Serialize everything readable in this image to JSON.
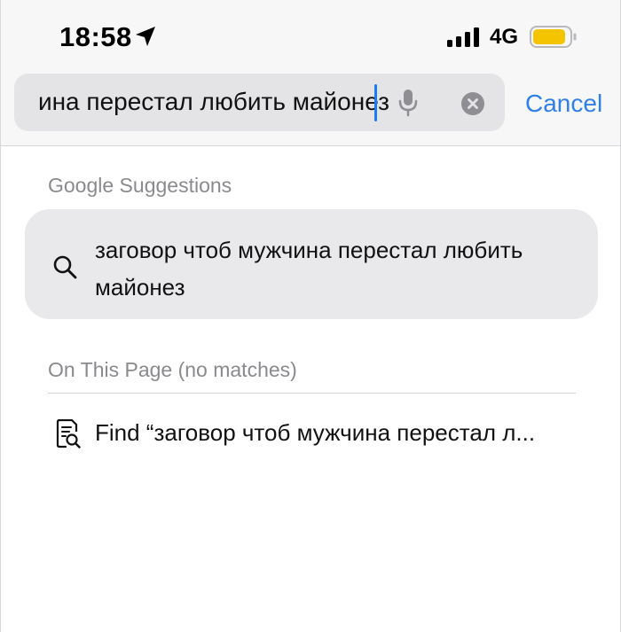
{
  "status_bar": {
    "time": "18:58",
    "network": "4G",
    "icons": [
      "location-arrow-icon",
      "signal-bars-icon",
      "battery-icon"
    ],
    "battery_color": "#f5c400"
  },
  "search_bar": {
    "query_visible": "ина перестал любить майонез",
    "cancel_label": "Cancel",
    "caret_color": "#1a7cf5",
    "accent_color": "#2f80e8",
    "icons": [
      "microphone-icon",
      "clear-icon"
    ]
  },
  "google_suggestions": {
    "header": "Google Suggestions",
    "items": [
      {
        "text": "заговор чтоб мужчина перестал любить майонез",
        "icon": "search-icon"
      }
    ]
  },
  "on_this_page": {
    "header": "On This Page (no matches)",
    "find_label": "Find “заговор чтоб мужчина перестал л...",
    "icon": "find-in-page-icon"
  }
}
